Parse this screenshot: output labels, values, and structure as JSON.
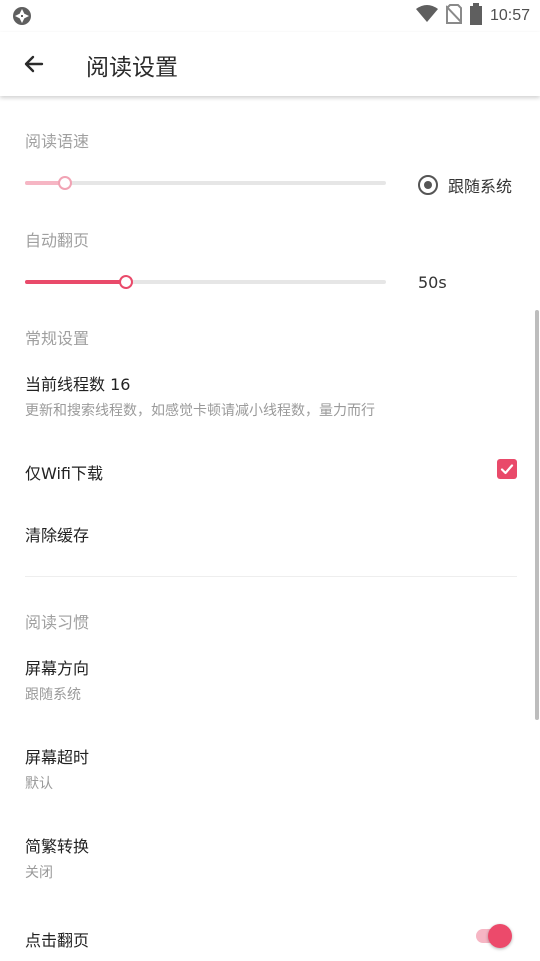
{
  "status_bar": {
    "time": "10:57",
    "icons": [
      "app-aperture-icon",
      "wifi-icon",
      "no-sim-icon",
      "battery-icon"
    ]
  },
  "app_bar": {
    "title": "阅读设置",
    "back_icon": "arrow-left-icon"
  },
  "colors": {
    "accent": "#e94a6a",
    "accent_light": "#f6b6c4",
    "section_text": "#a0a0a0"
  },
  "reading_speed": {
    "header": "阅读语速",
    "slider_fraction": 0.11,
    "follow_system_label": "跟随系统",
    "follow_system_selected": true
  },
  "auto_page": {
    "header": "自动翻页",
    "slider_fraction": 0.28,
    "value_label": "50s"
  },
  "general": {
    "header": "常规设置",
    "threads_title": "当前线程数 16",
    "threads_desc": "更新和搜索线程数，如感觉卡顿请减小线程数，量力而行",
    "wifi_only_label": "仅Wifi下载",
    "wifi_only_checked": true,
    "clear_cache_label": "清除缓存"
  },
  "reading_habits": {
    "header": "阅读习惯",
    "screen_orientation_title": "屏幕方向",
    "screen_orientation_value": "跟随系统",
    "screen_timeout_title": "屏幕超时",
    "screen_timeout_value": "默认",
    "chinese_convert_title": "简繁转换",
    "chinese_convert_value": "关闭",
    "tap_page_turn_title": "点击翻页",
    "tap_page_turn_on": true
  }
}
